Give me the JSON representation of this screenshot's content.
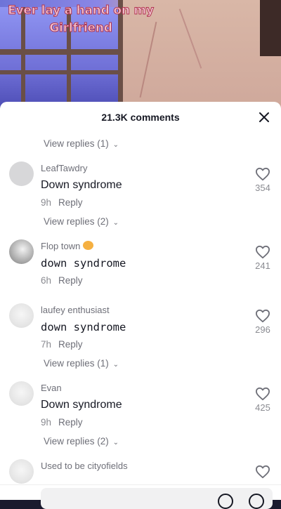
{
  "video": {
    "caption_line1": "Ever lay a hand on my",
    "caption_line2": "Girlfriend"
  },
  "sheet": {
    "title": "21.3K comments",
    "close_icon": "close-icon"
  },
  "comments": [
    {
      "replies_above": "View replies (1)",
      "username": "LeafTawdry",
      "text": "Down syndrome",
      "time": "9h",
      "reply_label": "Reply",
      "likes": "354",
      "replies_below": "View replies (2)"
    },
    {
      "username": "Flop town",
      "username_emoji": "smiling-emoji",
      "text": "down syndrome",
      "time": "6h",
      "reply_label": "Reply",
      "likes": "241"
    },
    {
      "username": "laufey enthusiast",
      "text": "down syndrome",
      "time": "7h",
      "reply_label": "Reply",
      "likes": "296",
      "replies_below": "View replies (1)"
    },
    {
      "username": "Evan",
      "text": "Down syndrome",
      "time": "9h",
      "reply_label": "Reply",
      "likes": "425",
      "replies_below": "View replies (2)"
    },
    {
      "username": "Used to be cityofields"
    }
  ],
  "icons": {
    "like": "heart-outline-icon",
    "chevron": "chevron-down-icon",
    "mention": "at-sign-icon",
    "emoji": "emoji-icon"
  }
}
